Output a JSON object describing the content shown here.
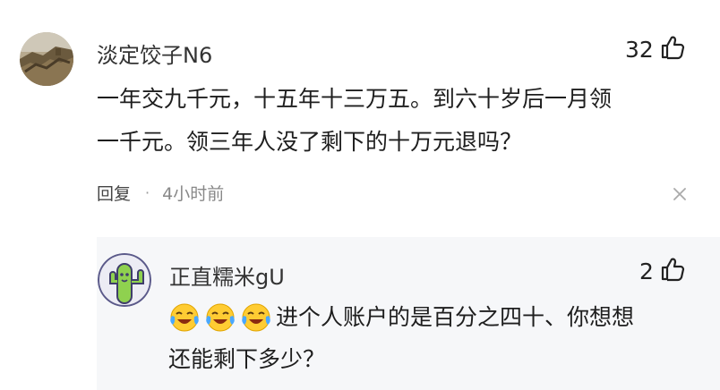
{
  "comment": {
    "username": "淡定饺子N6",
    "likes": "32",
    "text_line1": "一年交九千元，十五年十三万五。到六十岁后一月领",
    "text_line2": "一千元。领三年人没了剩下的十万元退吗？",
    "reply_label": "回复",
    "separator": "·",
    "time": "4小时前"
  },
  "reply": {
    "username": "正直糯米gU",
    "likes": "2",
    "emojis": [
      "laughing-crying-emoji",
      "laughing-crying-emoji",
      "laughing-crying-emoji"
    ],
    "text_line1": "进个人账户的是百分之四十、你想想",
    "text_line2": "还能剩下多少？"
  },
  "colors": {
    "reply_background": "#f6f7f9",
    "avatar_reply_accent": "#8fd14f",
    "avatar_reply_ring": "#5b5a8a"
  },
  "icons": [
    "thumbs-up-icon",
    "close-icon"
  ]
}
